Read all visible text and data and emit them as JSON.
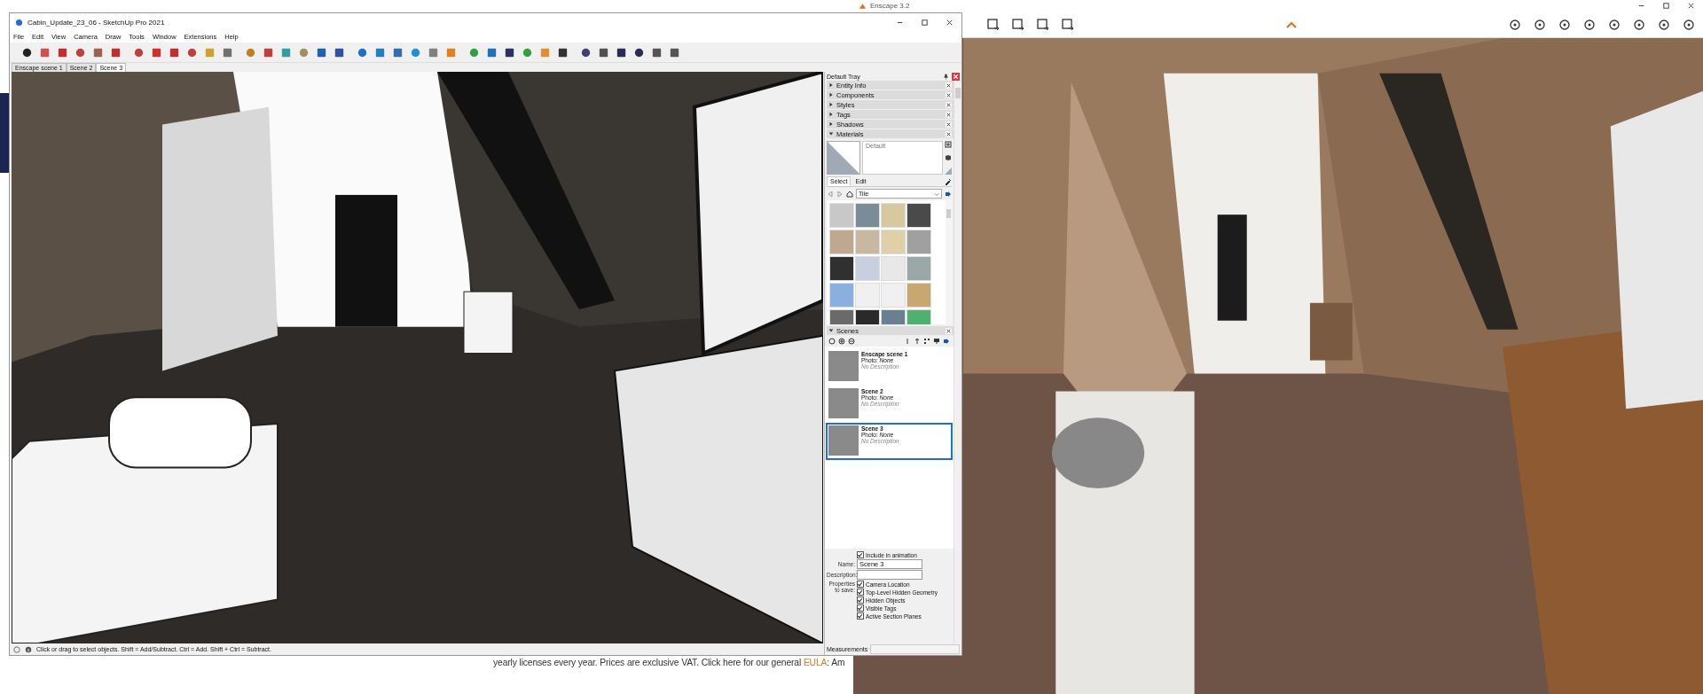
{
  "web_page": {
    "footer_text": "yearly licenses every year. Prices are exclusive VAT. Click here for our general ",
    "link": "EULA",
    "footer_tail": ": Am"
  },
  "sketchup": {
    "title": "Cabin_Update_23_06 - SketchUp Pro 2021",
    "menu": [
      "File",
      "Edit",
      "View",
      "Camera",
      "Draw",
      "Tools",
      "Window",
      "Extensions",
      "Help"
    ],
    "scene_tabs": [
      {
        "label": "Enscape scene 1",
        "selected": false
      },
      {
        "label": "Scene 2",
        "selected": false
      },
      {
        "label": "Scene 3",
        "selected": true
      }
    ],
    "tray": {
      "title": "Default Tray",
      "panels": [
        {
          "kind": "plain",
          "label": "Entity Info",
          "expanded": false
        },
        {
          "kind": "plain",
          "label": "Components",
          "expanded": false
        },
        {
          "kind": "plain",
          "label": "Styles",
          "expanded": false
        },
        {
          "kind": "plain",
          "label": "Tags",
          "expanded": false
        },
        {
          "kind": "plain",
          "label": "Shadows",
          "expanded": false
        },
        {
          "kind": "materials",
          "label": "Materials",
          "expanded": true
        },
        {
          "kind": "scenes",
          "label": "Scenes",
          "expanded": true
        }
      ],
      "materials": {
        "name": "Default",
        "tabs": [
          {
            "label": "Select",
            "selected": true
          },
          {
            "label": "Edit",
            "selected": false
          }
        ],
        "library": "Tile"
      },
      "scenes": [
        {
          "name": "Enscape scene 1",
          "photo": "Photo: *None*",
          "description": "No Description",
          "selected": false
        },
        {
          "name": "Scene 2",
          "photo": "Photo: *None*",
          "description": "No Description",
          "selected": false
        },
        {
          "name": "Scene 3",
          "photo": "Photo: *None*",
          "description": "No Description",
          "selected": true
        }
      ],
      "scene_props": {
        "include": {
          "label": "Include in animation",
          "checked": true
        },
        "name_label": "Name:",
        "name_value": "Scene 3",
        "description_label": "Description:",
        "properties_label": "Properties to save:",
        "properties": [
          {
            "label": "Camera Location",
            "checked": true
          },
          {
            "label": "Top-Level Hidden Geometry",
            "checked": true
          },
          {
            "label": "Hidden Objects",
            "checked": true
          },
          {
            "label": "Visible Tags",
            "checked": true
          },
          {
            "label": "Active Section Planes",
            "checked": true
          }
        ]
      }
    },
    "status": {
      "hint": "Click or drag to select objects. Shift = Add/Subtract. Ctrl = Add. Shift + Ctrl = Subtract.",
      "measurements_label": "Measurements"
    }
  },
  "enscape": {
    "title": "Enscape 3.2"
  }
}
